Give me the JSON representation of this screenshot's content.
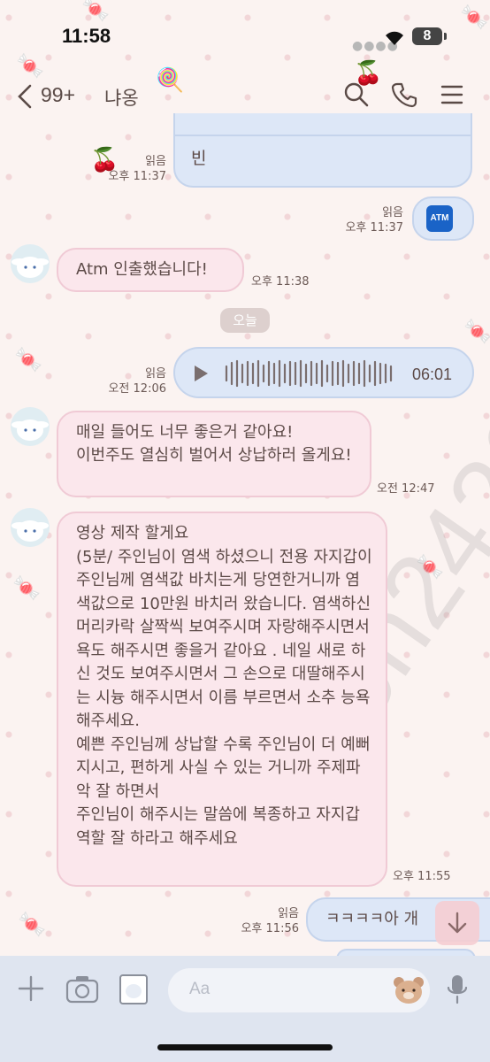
{
  "status": {
    "time": "11:58",
    "battery": "8"
  },
  "header": {
    "unread_count": "99+",
    "chat_name": "냐옹"
  },
  "messages": [
    {
      "type": "sent",
      "text": "빈",
      "read": "읽음",
      "time": "오후 11:37"
    },
    {
      "type": "sent-atm",
      "icon": "ATM",
      "read": "읽음",
      "time": "오후 11:37"
    },
    {
      "type": "recv",
      "text": "Atm 인출했습니다!",
      "time": "오후 11:38"
    },
    {
      "type": "sent-voice",
      "duration": "06:01",
      "read": "읽음",
      "time": "오전 12:06"
    },
    {
      "type": "recv",
      "text": "매일 들어도 너무 좋은거 같아요!\n이번주도 열심히 벌어서 상납하러 올게요!",
      "time": "오전 12:47"
    },
    {
      "type": "recv",
      "text": "영상 제작 할게요\n(5분/ 주인님이 염색 하셨으니 전용 자지갑이 주인님께 염색값 바치는게 당연한거니까 염색값으로 10만원 바치러 왔습니다. 염색하신 머리카락 살짝씩 보여주시며 자랑해주시면서 욕도 해주시면 좋을거 같아요 . 네일 새로 하신 것도 보여주시면서 그 손으로 대딸해주시는 시늉 해주시면서 이름 부르면서 소추 능욕해주세요.\n예쁜 주인님께 상납할 수록 주인님이 더 예뻐지시고, 편하게 사실 수 있는 거니까 주제파악 잘 하면서\n주인님이 해주시는 말씀에 복종하고 자지갑 역할 잘 하라고 해주세요",
      "time": "오후 11:55"
    },
    {
      "type": "sent",
      "text": "ㅋㅋㅋㅋ아 개",
      "read": "읽음",
      "time": "오후 11:56"
    }
  ],
  "date_divider": "오늘",
  "input": {
    "placeholder": "Aa"
  },
  "watermark": "nyeon2426",
  "colors": {
    "sent_bubble": "#dde7f7",
    "recv_bubble": "#fbe7ec",
    "footer": "#dfe5f0"
  }
}
